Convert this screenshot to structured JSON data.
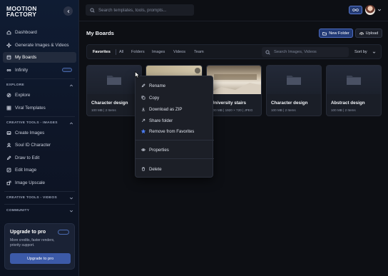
{
  "app": {
    "logo_line1": "MOOTION",
    "logo_line2": "FACTORY"
  },
  "top": {
    "search_placeholder": "Search templates, tools, prompts..."
  },
  "sidebar": {
    "items": [
      {
        "label": "Dashboard",
        "icon": "home-icon"
      },
      {
        "label": "Generate Images & Videos",
        "icon": "sparkle-icon"
      },
      {
        "label": "My Boards",
        "icon": "boards-icon",
        "active": true
      },
      {
        "label": "Infinity",
        "icon": "infinity-icon"
      }
    ],
    "explore_title": "EXPLORE",
    "explore": [
      {
        "label": "Explore",
        "icon": "compass-icon"
      },
      {
        "label": "Viral Templates",
        "icon": "template-icon"
      }
    ],
    "images_title": "CREATIVE TOOLS - IMAGES",
    "images": [
      {
        "label": "Create Images",
        "icon": "image-icon"
      },
      {
        "label": "Soul ID Character",
        "icon": "user-icon"
      },
      {
        "label": "Draw to Edit",
        "icon": "pen-icon"
      },
      {
        "label": "Edit Image",
        "icon": "edit-icon"
      },
      {
        "label": "Image Upscale",
        "icon": "upscale-icon"
      }
    ],
    "videos_title": "CREATIVE TOOLS - VIDEOS",
    "community_title": "COMMUNITY",
    "upgrade": {
      "title": "Upgrade to pro",
      "description": "More credits, faster renders, priority support.",
      "button": "Upgrade to pro"
    }
  },
  "main": {
    "title": "My Boards",
    "new_folder": "New Folder",
    "upload": "Upload",
    "tabs": [
      "Favorites",
      "All",
      "Folders",
      "Images",
      "Videos",
      "Team"
    ],
    "search_placeholder": "Search Images, Videos",
    "sort_label": "Sort by",
    "cards": [
      {
        "name": "Character design",
        "meta": "100 MB  |  2 Items",
        "kind": "folder"
      },
      {
        "name": "",
        "meta": "",
        "kind": "image"
      },
      {
        "name": "University stairs",
        "meta": "100 MB  |  1920 × 720  |  JPEG",
        "kind": "image"
      },
      {
        "name": "Character design",
        "meta": "100 MB  |  2 Items",
        "kind": "folder"
      },
      {
        "name": "Abstract design",
        "meta": "100 MB  |  2 Items",
        "kind": "folder"
      }
    ]
  },
  "context_menu": {
    "items": [
      "Rename",
      "Copy",
      "Download as ZIP",
      "Share folder",
      "Remove from Favorites",
      "Properties",
      "Delete"
    ]
  },
  "colors": {
    "accent": "#3c5aa8",
    "favorite_star": "#4a7bf0"
  }
}
